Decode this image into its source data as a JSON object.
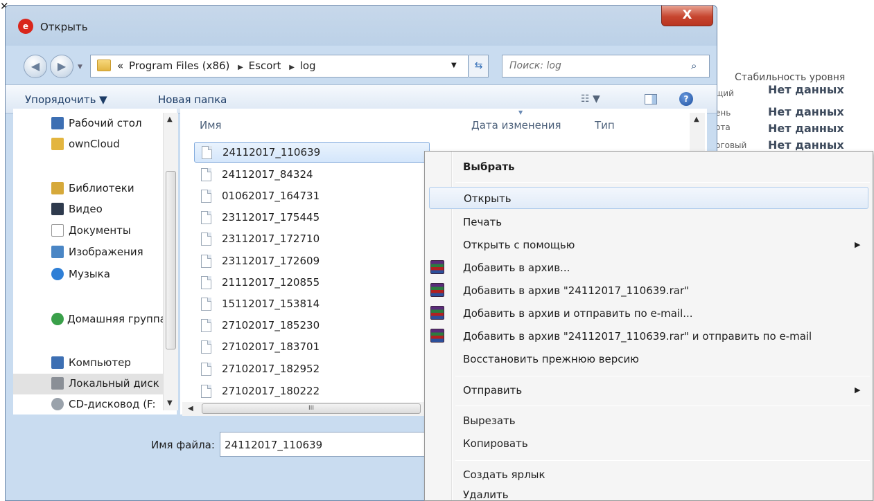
{
  "background_window": {
    "close_glyph": "✕",
    "stability_label": "Стабильность уровня",
    "rows": [
      {
        "cut": "щий",
        "value": "Нет данных"
      },
      {
        "cut": "ень",
        "value": "Нет данных"
      },
      {
        "cut": "ота",
        "value": "Нет данных"
      },
      {
        "cut": "оговый",
        "value": "Нет данных"
      }
    ]
  },
  "dialog": {
    "title": "Открыть",
    "close_glyph": "X",
    "address": {
      "prefix": "«",
      "crumbs": [
        "Program Files (x86)",
        "Escort",
        "log"
      ],
      "separator": "▶"
    },
    "search_placeholder": "Поиск: log",
    "toolbar": {
      "organize": "Упорядочить ▼",
      "new_folder": "Новая папка"
    }
  },
  "nav_pane": {
    "items": [
      {
        "label": "Рабочий стол",
        "icon": "desktop-icon",
        "color": "#3d6fb3"
      },
      {
        "label": "ownCloud",
        "icon": "folder-icon",
        "color": "#e3b53f"
      },
      {
        "label": "Библиотеки",
        "icon": "libraries-icon",
        "color": "#d6a93a"
      },
      {
        "label": "Видео",
        "icon": "video-icon",
        "color": "#2e3a4d"
      },
      {
        "label": "Документы",
        "icon": "documents-icon",
        "color": "#c9c9c9"
      },
      {
        "label": "Изображения",
        "icon": "pictures-icon",
        "color": "#4a86c5"
      },
      {
        "label": "Музыка",
        "icon": "music-icon",
        "color": "#2f7fd6"
      },
      {
        "label": "Домашняя группа",
        "icon": "homegroup-icon",
        "color": "#3aa04a"
      },
      {
        "label": "Компьютер",
        "icon": "computer-icon",
        "color": "#3d6fb3"
      },
      {
        "label": "Локальный диск",
        "icon": "local-disk-icon",
        "color": "#8a8f96"
      },
      {
        "label": "CD-дисковод (F:",
        "icon": "cd-drive-icon",
        "color": "#9aa2ab"
      }
    ]
  },
  "file_list": {
    "columns": {
      "name": "Имя",
      "date": "Дата изменения",
      "type": "Тип"
    },
    "files": [
      "24112017_110639",
      "24112017_84324",
      "01062017_164731",
      "23112017_175445",
      "23112017_172710",
      "23112017_172609",
      "21112017_120855",
      "15112017_153814",
      "27102017_185230",
      "27102017_183701",
      "27102017_182952",
      "27102017_180222"
    ],
    "hscroll_grip": "III"
  },
  "bottom": {
    "filename_label": "Имя файла:",
    "filename_value": "24112017_110639"
  },
  "context_menu": {
    "items": [
      {
        "label": "Выбрать",
        "bold": true
      },
      {
        "label": "Открыть",
        "hover": true
      },
      {
        "label": "Печать"
      },
      {
        "label": "Открыть с помощью",
        "submenu": true
      },
      {
        "label": "Добавить в архив...",
        "rar": true
      },
      {
        "label": "Добавить в архив \"24112017_110639.rar\"",
        "rar": true
      },
      {
        "label": "Добавить в архив и отправить по e-mail...",
        "rar": true
      },
      {
        "label": "Добавить в архив \"24112017_110639.rar\" и отправить по e-mail",
        "rar": true
      },
      {
        "label": "Восстановить прежнюю версию"
      },
      {
        "label": "Отправить",
        "submenu": true
      },
      {
        "label": "Вырезать"
      },
      {
        "label": "Копировать"
      },
      {
        "label": "Создать ярлык"
      },
      {
        "label": "Удалить"
      }
    ],
    "submenu_glyph": "▶"
  }
}
